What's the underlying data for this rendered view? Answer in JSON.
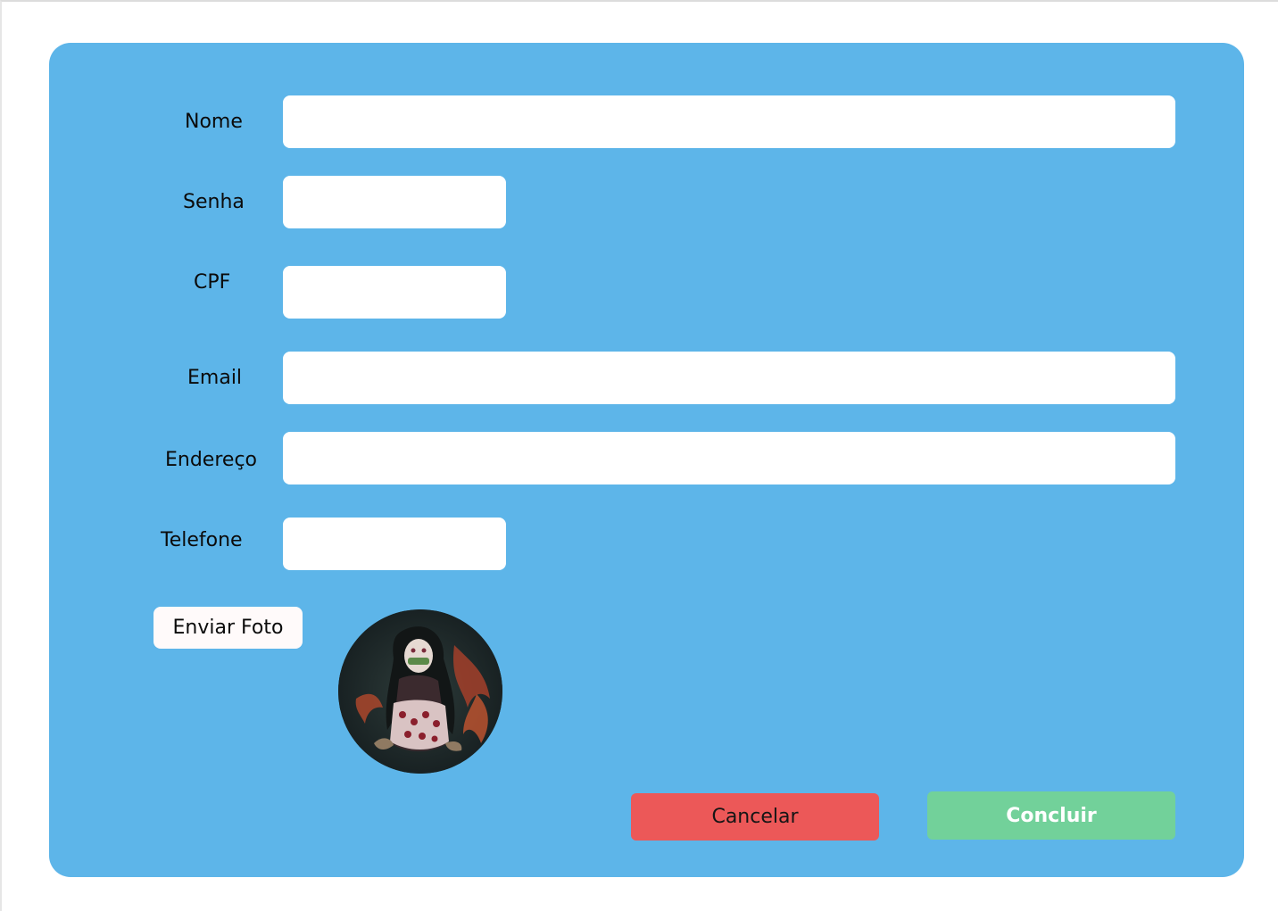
{
  "form": {
    "fields": {
      "nome": {
        "label": "Nome",
        "value": ""
      },
      "senha": {
        "label": "Senha",
        "value": ""
      },
      "cpf": {
        "label": "CPF",
        "value": ""
      },
      "email": {
        "label": "Email",
        "value": ""
      },
      "endereco": {
        "label": "Endereço",
        "value": ""
      },
      "telefone": {
        "label": "Telefone",
        "value": ""
      }
    },
    "upload_button_label": "Enviar Foto",
    "cancel_button_label": "Cancelar",
    "submit_button_label": "Concluir"
  },
  "colors": {
    "card_background": "#5db5e9",
    "cancel_button": "#ec5858",
    "submit_button": "#72d19a"
  }
}
